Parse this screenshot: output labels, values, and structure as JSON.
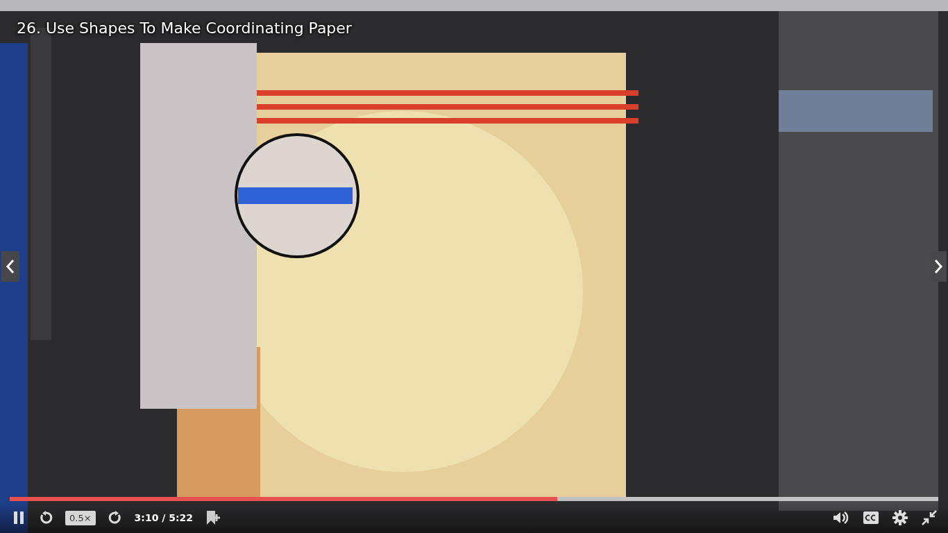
{
  "video": {
    "kind": "picture",
    "title": "26. Use Shapes To Make Coordinating Paper"
  },
  "controls": {
    "playing": true,
    "speed": "0.5×",
    "time": "3:10 / 5:22",
    "progress": {
      "level": 0.59
    }
  }
}
